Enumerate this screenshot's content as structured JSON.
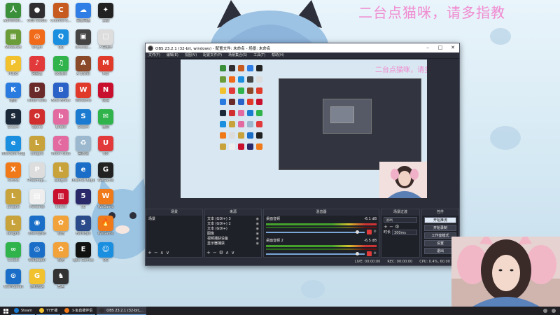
{
  "watermark": "二台点猫咪，请多指教",
  "desktop": {
    "icons": [
      {
        "label": "Administr...",
        "color": "#3a8f3a",
        "glyph": "人"
      },
      {
        "label": "OBS Studio",
        "color": "#302e31",
        "glyph": "●"
      },
      {
        "label": "Counter-S...",
        "color": "#c75a1e",
        "glyph": "C"
      },
      {
        "label": "百度网盘",
        "color": "#2e7ee6",
        "glyph": "☁"
      },
      {
        "label": "主播",
        "color": "#222",
        "glyph": "✦"
      },
      {
        "label": "Minecraft",
        "color": "#6a9c3a",
        "glyph": "▦"
      },
      {
        "label": "Origin",
        "color": "#f06a1a",
        "glyph": "◎"
      },
      {
        "label": "QQ",
        "color": "#1a8fe0",
        "glyph": "Q"
      },
      {
        "label": "Uncrea...",
        "color": "#444",
        "glyph": "▣"
      },
      {
        "label": "人生重开",
        "color": "#ddd",
        "glyph": "□"
      },
      {
        "label": "PUBG",
        "color": "#f2c12e",
        "glyph": "P"
      },
      {
        "label": "网易云",
        "color": "#e23a3a",
        "glyph": "♪"
      },
      {
        "label": "QQ音乐",
        "color": "#2fb34a",
        "glyph": "♫"
      },
      {
        "label": "A Bullet",
        "color": "#8a4a2a",
        "glyph": "A"
      },
      {
        "label": "MSI",
        "color": "#e03a2a",
        "glyph": "M"
      },
      {
        "label": "酷狗",
        "color": "#2a7be0",
        "glyph": "K"
      },
      {
        "label": "Dead Cells",
        "color": "#6a2a2a",
        "glyph": "D"
      },
      {
        "label": "Blue Effect",
        "color": "#2a62c8",
        "glyph": "B"
      },
      {
        "label": "WeGame",
        "color": "#e03a2a",
        "glyph": "W"
      },
      {
        "label": "网易",
        "color": "#c8102e",
        "glyph": "N"
      },
      {
        "label": "Steam",
        "color": "#1b2838",
        "glyph": "S"
      },
      {
        "label": "Opera",
        "color": "#d12f2f",
        "glyph": "O"
      },
      {
        "label": "Bilibili",
        "color": "#e26aa0",
        "glyph": "b"
      },
      {
        "label": "Steam",
        "color": "#1b7bd1",
        "glyph": "S"
      },
      {
        "label": "微信",
        "color": "#2fb34a",
        "glyph": "✉"
      },
      {
        "label": "Microsoft Edge",
        "color": "#1a8fe0",
        "glyph": "e"
      },
      {
        "label": "League",
        "color": "#c8a23a",
        "glyph": "L"
      },
      {
        "label": "Moon Glob",
        "color": "#e26aa0",
        "glyph": "☾"
      },
      {
        "label": "回收站",
        "color": "#9bb8cf",
        "glyph": "♻"
      },
      {
        "label": "Ubi",
        "color": "#e23a3a",
        "glyph": "U"
      },
      {
        "label": "Xmind",
        "color": "#f07a1a",
        "glyph": "X"
      },
      {
        "label": "Phasmop...",
        "color": "#ddd",
        "glyph": "P"
      },
      {
        "label": "League",
        "color": "#c8a23a",
        "glyph": "L"
      },
      {
        "label": "Internet Explorer",
        "color": "#1a6ec8",
        "glyph": "e"
      },
      {
        "label": "WeGame",
        "color": "#222",
        "glyph": "G"
      },
      {
        "label": "League",
        "color": "#c8a23a",
        "glyph": "L"
      },
      {
        "label": "Personal",
        "color": "#eee",
        "glyph": "▤"
      },
      {
        "label": "bilibili",
        "color": "#c8102e",
        "glyph": "▥"
      },
      {
        "label": "5E",
        "color": "#2a2a6a",
        "glyph": "5"
      },
      {
        "label": "WeGame",
        "color": "#f07a1a",
        "glyph": "W"
      },
      {
        "label": "League",
        "color": "#c8a23a",
        "glyph": "L"
      },
      {
        "label": "Soundpad",
        "color": "#1a6ec8",
        "glyph": "◉"
      },
      {
        "label": "萌宠",
        "color": "#f2a23a",
        "glyph": "✿"
      },
      {
        "label": "BattlEye",
        "color": "#2a4a8a",
        "glyph": "5"
      },
      {
        "label": "WeGame",
        "color": "#f07a1a",
        "glyph": "🔥"
      },
      {
        "label": "CCtalk",
        "color": "#2fb34a",
        "glyph": "∞"
      },
      {
        "label": "Wallpaper",
        "color": "#1a6ec8",
        "glyph": "◎"
      },
      {
        "label": "萌宠",
        "color": "#f2a23a",
        "glyph": "✿"
      },
      {
        "label": "Epic Games",
        "color": "#111",
        "glyph": "E"
      },
      {
        "label": "QQ",
        "color": "#1a8fe0",
        "glyph": "☺"
      },
      {
        "label": "TeamSpeak",
        "color": "#1a6ec8",
        "glyph": "⊙"
      },
      {
        "label": "游戏加速",
        "color": "#f2c12e",
        "glyph": "G"
      },
      {
        "label": "角色",
        "color": "#333",
        "glyph": "♞"
      }
    ]
  },
  "obs": {
    "title": "OBS 23.2.1 (32-bit, windows) - 配置文件: 未命名 - 场景: 未命名",
    "menu": [
      "文件(F)",
      "编辑(E)",
      "视图(V)",
      "配置文件(P)",
      "场景集合(S)",
      "工具(T)",
      "帮助(H)"
    ],
    "docks": {
      "scenes": {
        "header": "场景",
        "items": [
          "场景"
        ]
      },
      "sources": {
        "header": "来源",
        "items": [
          "文本 (GDI+) 3",
          "文本 (GDI+) 2",
          "文本 (GDI+)",
          "图像",
          "视频捕获设备",
          "显示器捕获"
        ]
      },
      "mixer": {
        "header": "混音器",
        "channels": [
          {
            "name": "桌面音频",
            "db": "-6.1 dB"
          },
          {
            "name": "桌面音频 2",
            "db": "-6.5 dB"
          }
        ]
      },
      "transitions": {
        "header": "场景过渡",
        "type": "淡出",
        "duration_label": "时长",
        "duration": "300ms"
      },
      "controls": {
        "header": "控件",
        "buttons": [
          "开始推流",
          "开始录制",
          "工作室模式",
          "设置",
          "退出"
        ]
      }
    },
    "status": {
      "live": "LIVE: 00:00:00",
      "rec": "REC: 00:00:00",
      "cpu": "CPU: 0.4%, 60.00 fps"
    }
  },
  "taskbar": {
    "items": [
      {
        "label": "Steam",
        "color": "#1b7bd1"
      },
      {
        "label": "YY开播",
        "color": "#f2c12e"
      },
      {
        "label": "斗鱼直播伴侣",
        "color": "#f07a1a"
      },
      {
        "label": "OBS 23.2.1 (32-bit,...",
        "color": "#302e31"
      }
    ]
  }
}
